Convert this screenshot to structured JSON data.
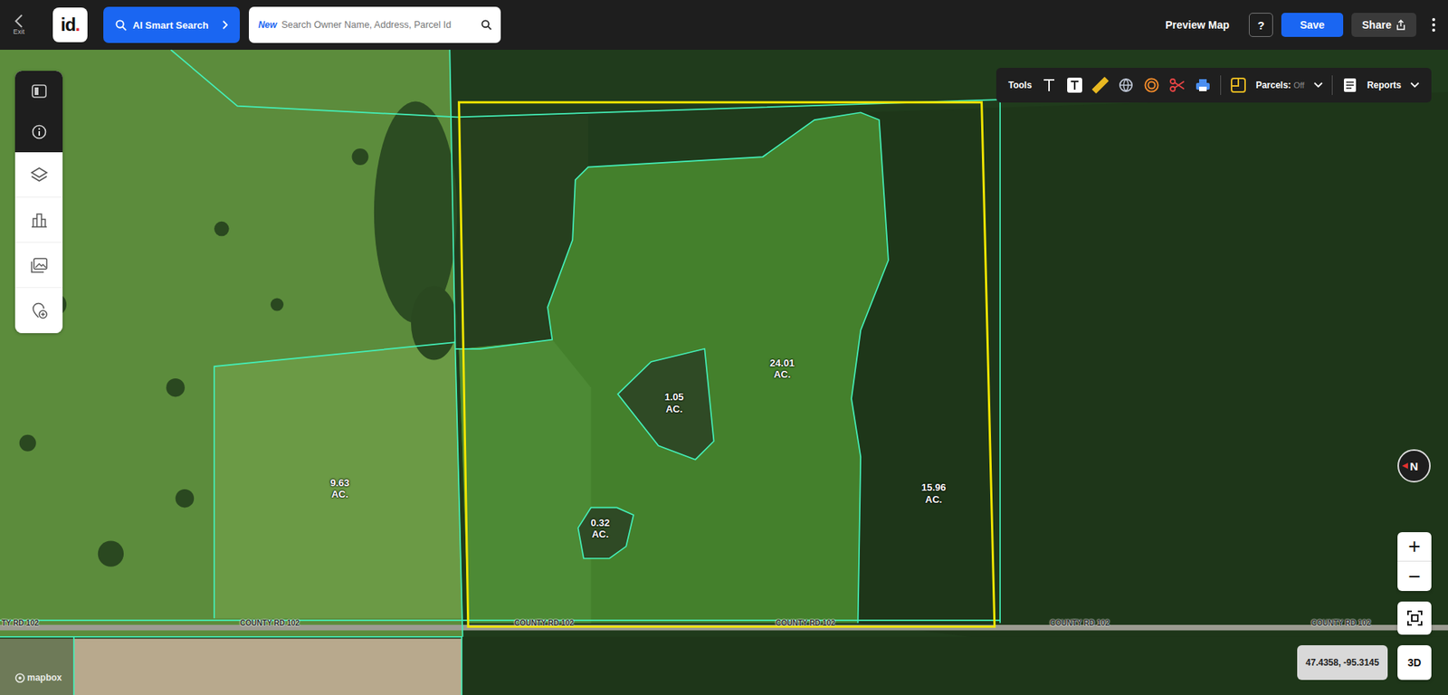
{
  "topbar": {
    "exit": "Exit",
    "logo": "id",
    "logo_dot": ".",
    "ai_search": "AI Smart Search",
    "search": {
      "badge": "New",
      "placeholder": "Search Owner Name, Address, Parcel Id"
    },
    "preview": "Preview Map",
    "help": "?",
    "save": "Save",
    "share": "Share"
  },
  "toolbar": {
    "tools": "Tools",
    "parcels_label": "Parcels:",
    "parcels_state": "Off",
    "reports": "Reports"
  },
  "map": {
    "parcels": [
      {
        "acres": "9.63",
        "unit": "AC."
      },
      {
        "acres": "24.01",
        "unit": "AC."
      },
      {
        "acres": "1.05",
        "unit": "AC."
      },
      {
        "acres": "0.32",
        "unit": "AC."
      },
      {
        "acres": "15.96",
        "unit": "AC."
      }
    ],
    "roads": [
      "TY RD 102",
      "COUNTY RD 102",
      "COUNTY RD 102",
      "COUNTY RD 102",
      "COUNTY RD 102",
      "COUNTY RD 102"
    ],
    "compass": "N",
    "zoom_in": "+",
    "zoom_out": "−",
    "view_3d": "3D",
    "coordinates": "47.4358, -95.3145",
    "attribution": "mapbox"
  }
}
